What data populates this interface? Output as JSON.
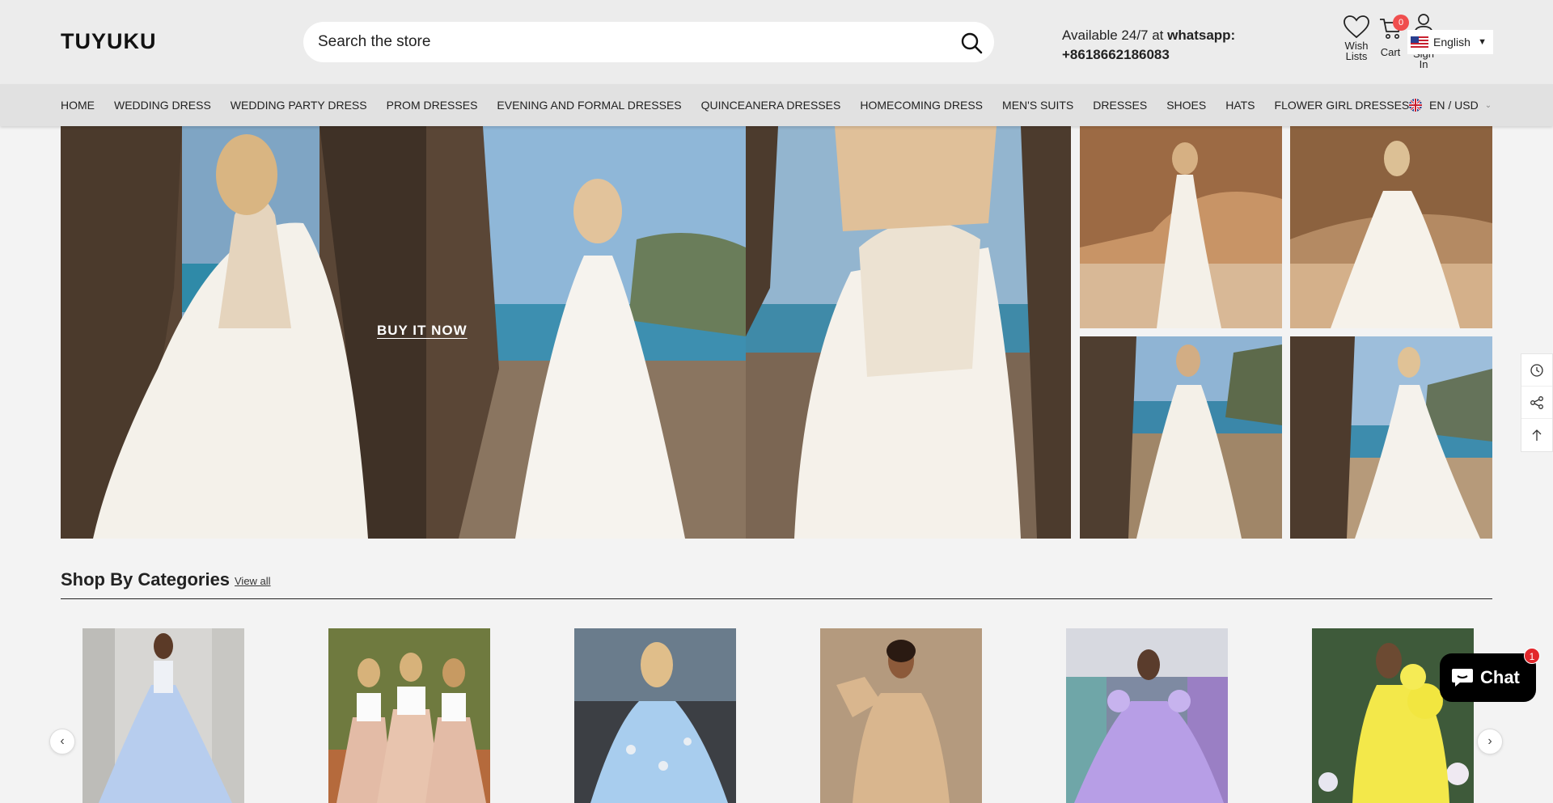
{
  "header": {
    "logo": "TUYUKU",
    "search_placeholder": "Search the store",
    "contact_prefix": "Available 24/7 at",
    "contact_channel": "whatsapp:",
    "contact_phone": "+8618662186083",
    "wish_label_1": "Wish",
    "wish_label_2": "Lists",
    "cart_label": "Cart",
    "cart_count": "0",
    "signin_label_1": "Sign",
    "signin_label_2": "In",
    "language": "English"
  },
  "nav": {
    "items": [
      "HOME",
      "WEDDING DRESS",
      "WEDDING PARTY DRESS",
      "PROM DRESSES",
      "EVENING AND FORMAL DRESSES",
      "QUINCEANERA DRESSES",
      "HOMECOMING DRESS",
      "MEN'S SUITS",
      "DRESSES",
      "SHOES",
      "HATS",
      "FLOWER GIRL DRESSES"
    ],
    "currency": "EN / USD"
  },
  "hero": {
    "cta": "BUY IT NOW"
  },
  "categories": {
    "title": "Shop By Categories",
    "view_all": "View all"
  },
  "chat": {
    "label": "Chat",
    "badge": "1"
  },
  "colors": {
    "header_bg": "#ececec",
    "nav_bg": "#e1e1e1",
    "badge_red": "#f04e4e",
    "chat_bg": "#000000"
  },
  "icons": [
    "search-icon",
    "heart-icon",
    "cart-icon",
    "user-icon",
    "us-flag-icon",
    "uk-flag-icon",
    "history-icon",
    "share-icon",
    "arrow-up-icon",
    "chevron-left-icon",
    "chevron-right-icon",
    "chat-bubble-icon"
  ]
}
